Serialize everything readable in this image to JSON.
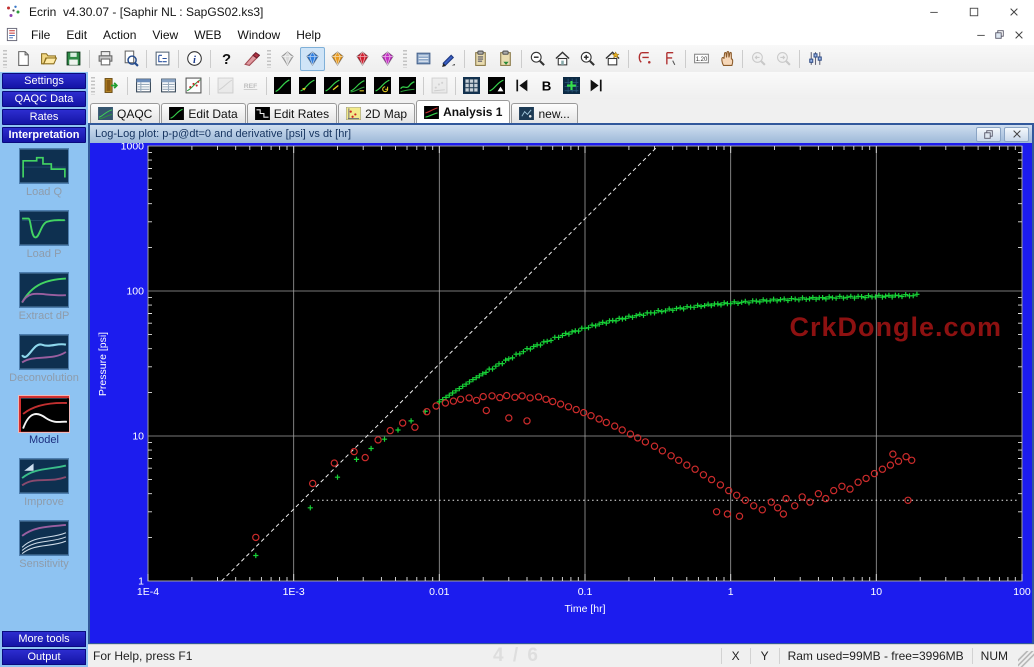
{
  "titlebar": {
    "title": "Ecrin  v4.30.07 - [Saphir NL : SapGS02.ks3]",
    "controls": [
      {
        "name": "minimize-button",
        "icon": "minimize"
      },
      {
        "name": "maximize-button",
        "icon": "maximize"
      },
      {
        "name": "close-button",
        "icon": "close"
      }
    ]
  },
  "menubar": {
    "menus": [
      "File",
      "Edit",
      "Action",
      "View",
      "WEB",
      "Window",
      "Help"
    ],
    "mdi_controls": [
      {
        "name": "mdi-minimize-button",
        "icon": "minimize"
      },
      {
        "name": "mdi-restore-button",
        "icon": "restore"
      },
      {
        "name": "mdi-close-button",
        "icon": "close"
      }
    ]
  },
  "toolbar_main": {
    "groups": [
      {
        "items": [
          {
            "icon": "new-document"
          },
          {
            "icon": "open-file"
          },
          {
            "icon": "save-file"
          },
          {
            "sep": true
          },
          {
            "icon": "print"
          },
          {
            "icon": "print-preview"
          },
          {
            "sep": true
          },
          {
            "icon": "report-layout"
          },
          {
            "sep": true
          },
          {
            "icon": "info-about"
          },
          {
            "sep": true
          },
          {
            "icon": "help-question"
          },
          {
            "icon": "clean-brush"
          }
        ]
      },
      {
        "items": [
          {
            "icon": "gem",
            "name": "gem-gray",
            "color": "#d9d9d9"
          },
          {
            "icon": "gem",
            "name": "gem-blue",
            "color": "#2f7fe0",
            "selected": true
          },
          {
            "icon": "gem",
            "name": "gem-amber",
            "color": "#e89a1f"
          },
          {
            "icon": "gem",
            "name": "gem-red",
            "color": "#d01f2f"
          },
          {
            "icon": "gem",
            "name": "gem-magenta",
            "color": "#c32fc3"
          }
        ]
      },
      {
        "items": [
          {
            "icon": "list-view"
          },
          {
            "icon": "pen-edit"
          },
          {
            "sep": true
          },
          {
            "icon": "copy-settings"
          },
          {
            "icon": "paste-settings"
          },
          {
            "sep": true
          },
          {
            "icon": "zoom-out"
          },
          {
            "icon": "home-view"
          },
          {
            "icon": "zoom-in"
          },
          {
            "icon": "home-new"
          },
          {
            "sep": true
          },
          {
            "icon": "draw-line"
          },
          {
            "icon": "draw-text"
          },
          {
            "sep": true
          },
          {
            "icon": "decimal-format",
            "label": "1.20"
          },
          {
            "icon": "pan-hand"
          },
          {
            "sep": true
          },
          {
            "icon": "zoom-previous",
            "disabled": true
          },
          {
            "icon": "zoom-next",
            "disabled": true
          },
          {
            "sep": true
          },
          {
            "icon": "preferences-sliders"
          }
        ]
      }
    ]
  },
  "toolbar_analysis": {
    "items": [
      {
        "icon": "extract-exit"
      },
      {
        "sep": true
      },
      {
        "icon": "data-table"
      },
      {
        "icon": "report-table"
      },
      {
        "icon": "scatter-qaqc"
      },
      {
        "sep": true
      },
      {
        "icon": "plot-gray",
        "disabled": true
      },
      {
        "icon": "ref-label",
        "label": "REF",
        "disabled": true
      },
      {
        "sep": true
      },
      {
        "icon": "curve-basic"
      },
      {
        "icon": "curve-shift"
      },
      {
        "icon": "curve-slope"
      },
      {
        "icon": "curve-double"
      },
      {
        "icon": "curve-refresh"
      },
      {
        "icon": "curve-smooth"
      },
      {
        "sep": true
      },
      {
        "icon": "points-gray",
        "disabled": true
      },
      {
        "sep": true
      },
      {
        "icon": "calculator-grid"
      },
      {
        "icon": "curve-model"
      },
      {
        "icon": "first-arrow"
      },
      {
        "icon": "bold-b",
        "label": "B"
      },
      {
        "icon": "add-grid"
      },
      {
        "icon": "last-arrow"
      }
    ]
  },
  "tabs": {
    "items": [
      {
        "label": "QAQC",
        "icon": "tab-qaqc"
      },
      {
        "label": "Edit Data",
        "icon": "tab-edit-data"
      },
      {
        "label": "Edit Rates",
        "icon": "tab-edit-rates"
      },
      {
        "label": "2D Map",
        "icon": "tab-2d-map"
      },
      {
        "label": "Analysis 1",
        "icon": "tab-analysis",
        "active": true
      },
      {
        "label": "new...",
        "icon": "tab-new"
      }
    ]
  },
  "sidebar": {
    "nav_buttons": [
      {
        "label": "Settings"
      },
      {
        "label": "QAQC Data"
      },
      {
        "label": "Rates"
      },
      {
        "label": "Interpretation",
        "active": true
      }
    ],
    "tools": [
      {
        "label": "Load Q",
        "icon": "load-q"
      },
      {
        "label": "Load P",
        "icon": "load-p"
      },
      {
        "label": "Extract dP",
        "icon": "extract-dp"
      },
      {
        "label": "Deconvolution",
        "icon": "deconvolution"
      },
      {
        "label": "Model",
        "icon": "model",
        "selected": true
      },
      {
        "label": "Improve",
        "icon": "improve"
      },
      {
        "label": "Sensitivity",
        "icon": "sensitivity"
      }
    ],
    "bottom_buttons": [
      {
        "label": "More tools"
      },
      {
        "label": "Output"
      }
    ]
  },
  "plot_window": {
    "title": "Log-Log plot: p-p@dt=0 and derivative [psi] vs dt [hr]",
    "buttons": [
      {
        "name": "plot-restore-button",
        "icon": "restore"
      },
      {
        "name": "plot-close-button",
        "icon": "close"
      }
    ]
  },
  "status_bar": {
    "help_text": "For Help, press F1",
    "page_indicator": "4 / 6",
    "coord_cells": [
      "X",
      "Y"
    ],
    "ram_text": "Ram used=99MB - free=3996MB",
    "keyboard_state": "NUM"
  },
  "chart_data": {
    "type": "scatter",
    "title": "Log-Log plot: p-p@dt=0 and derivative [psi] vs dt [hr]",
    "xlabel": "Time [hr]",
    "ylabel": "Pressure [psi]",
    "x_scale": "log",
    "y_scale": "log",
    "xlim": [
      0.0001,
      100
    ],
    "ylim": [
      1,
      1000
    ],
    "x_tick_labels": [
      "1E-4",
      "1E-3",
      "0.01",
      "0.1",
      "1",
      "10",
      "100"
    ],
    "y_tick_labels": [
      "1",
      "10",
      "100",
      "1000"
    ],
    "grid": true,
    "background": "#000000",
    "frame_color": "#1c1cee",
    "grid_color": "#a0a0a0",
    "watermark": {
      "text": "CrkDongle.com",
      "color": "#991313"
    },
    "reference_lines": [
      {
        "name": "unit-slope-line",
        "style": "dashed",
        "from": [
          0.00032,
          1
        ],
        "to": [
          0.317,
          1000
        ]
      },
      {
        "name": "derivative-stabilization-line",
        "style": "dotted",
        "y": 3.6,
        "from_x": 0.00136,
        "to_x": 95
      }
    ],
    "series": [
      {
        "name": "p-p@dt=0",
        "marker": "plus",
        "color": "#17d337",
        "dense_from": 0.009,
        "markers_per_decade": 42,
        "points": [
          [
            0.00055,
            1.5
          ],
          [
            0.0013,
            3.2
          ],
          [
            0.002,
            5.2
          ],
          [
            0.0027,
            6.9
          ],
          [
            0.0034,
            8.2
          ],
          [
            0.0042,
            9.5
          ],
          [
            0.0052,
            11.0
          ],
          [
            0.0064,
            12.7
          ],
          [
            0.008,
            14.8
          ],
          [
            0.01,
            17.2
          ],
          [
            0.013,
            20.5
          ],
          [
            0.017,
            24.5
          ],
          [
            0.022,
            28.5
          ],
          [
            0.03,
            34.0
          ],
          [
            0.04,
            39.5
          ],
          [
            0.055,
            45.0
          ],
          [
            0.07,
            49.5
          ],
          [
            0.1,
            55.5
          ],
          [
            0.14,
            61.0
          ],
          [
            0.2,
            66.0
          ],
          [
            0.3,
            71.5
          ],
          [
            0.45,
            76.0
          ],
          [
            0.7,
            80.0
          ],
          [
            1.0,
            82.5
          ],
          [
            1.5,
            85.0
          ],
          [
            2.2,
            87.0
          ],
          [
            3.3,
            88.5
          ],
          [
            5.0,
            90.0
          ],
          [
            7.5,
            91.0
          ],
          [
            11.0,
            92.0
          ],
          [
            15.0,
            92.8
          ],
          [
            19.0,
            93.5
          ]
        ]
      },
      {
        "name": "derivative",
        "marker": "circle",
        "color": "#cd2c2c",
        "points": [
          [
            0.00055,
            2.0
          ],
          [
            0.00135,
            4.7
          ],
          [
            0.0019,
            6.5
          ],
          [
            0.0026,
            7.8
          ],
          [
            0.0031,
            7.1
          ],
          [
            0.0038,
            9.4
          ],
          [
            0.0046,
            10.9
          ],
          [
            0.0056,
            12.3
          ],
          [
            0.0068,
            11.5
          ],
          [
            0.0082,
            14.7
          ],
          [
            0.0095,
            16.1
          ],
          [
            0.011,
            16.9
          ],
          [
            0.0125,
            17.4
          ],
          [
            0.014,
            17.9
          ],
          [
            0.016,
            18.3
          ],
          [
            0.018,
            17.6
          ],
          [
            0.02,
            18.7
          ],
          [
            0.021,
            15.0
          ],
          [
            0.023,
            18.9
          ],
          [
            0.026,
            18.4
          ],
          [
            0.029,
            19.0
          ],
          [
            0.03,
            13.3
          ],
          [
            0.033,
            18.5
          ],
          [
            0.037,
            18.9
          ],
          [
            0.04,
            12.7
          ],
          [
            0.042,
            18.3
          ],
          [
            0.048,
            18.6
          ],
          [
            0.054,
            17.9
          ],
          [
            0.06,
            17.3
          ],
          [
            0.068,
            16.6
          ],
          [
            0.077,
            15.9
          ],
          [
            0.087,
            15.2
          ],
          [
            0.098,
            14.5
          ],
          [
            0.11,
            13.8
          ],
          [
            0.125,
            13.1
          ],
          [
            0.14,
            12.4
          ],
          [
            0.16,
            11.7
          ],
          [
            0.18,
            11.0
          ],
          [
            0.205,
            10.3
          ],
          [
            0.23,
            9.7
          ],
          [
            0.26,
            9.1
          ],
          [
            0.3,
            8.5
          ],
          [
            0.34,
            7.9
          ],
          [
            0.39,
            7.3
          ],
          [
            0.44,
            6.8
          ],
          [
            0.5,
            6.3
          ],
          [
            0.57,
            5.9
          ],
          [
            0.65,
            5.4
          ],
          [
            0.74,
            5.0
          ],
          [
            0.8,
            3.0
          ],
          [
            0.85,
            4.6
          ],
          [
            0.95,
            2.9
          ],
          [
            0.97,
            4.2
          ],
          [
            1.1,
            3.9
          ],
          [
            1.15,
            2.8
          ],
          [
            1.26,
            3.6
          ],
          [
            1.44,
            3.3
          ],
          [
            1.65,
            3.1
          ],
          [
            1.9,
            3.5
          ],
          [
            2.1,
            3.2
          ],
          [
            2.3,
            2.9
          ],
          [
            2.4,
            3.7
          ],
          [
            2.75,
            3.3
          ],
          [
            3.1,
            3.8
          ],
          [
            3.5,
            3.5
          ],
          [
            4.0,
            4.0
          ],
          [
            4.5,
            3.7
          ],
          [
            5.1,
            4.2
          ],
          [
            5.8,
            4.5
          ],
          [
            6.6,
            4.3
          ],
          [
            7.5,
            4.8
          ],
          [
            8.5,
            5.1
          ],
          [
            9.7,
            5.5
          ],
          [
            11.0,
            5.9
          ],
          [
            12.5,
            6.3
          ],
          [
            13.0,
            7.5
          ],
          [
            14.2,
            6.7
          ],
          [
            16.0,
            7.2
          ],
          [
            16.5,
            3.6
          ],
          [
            17.5,
            6.8
          ]
        ]
      }
    ]
  }
}
